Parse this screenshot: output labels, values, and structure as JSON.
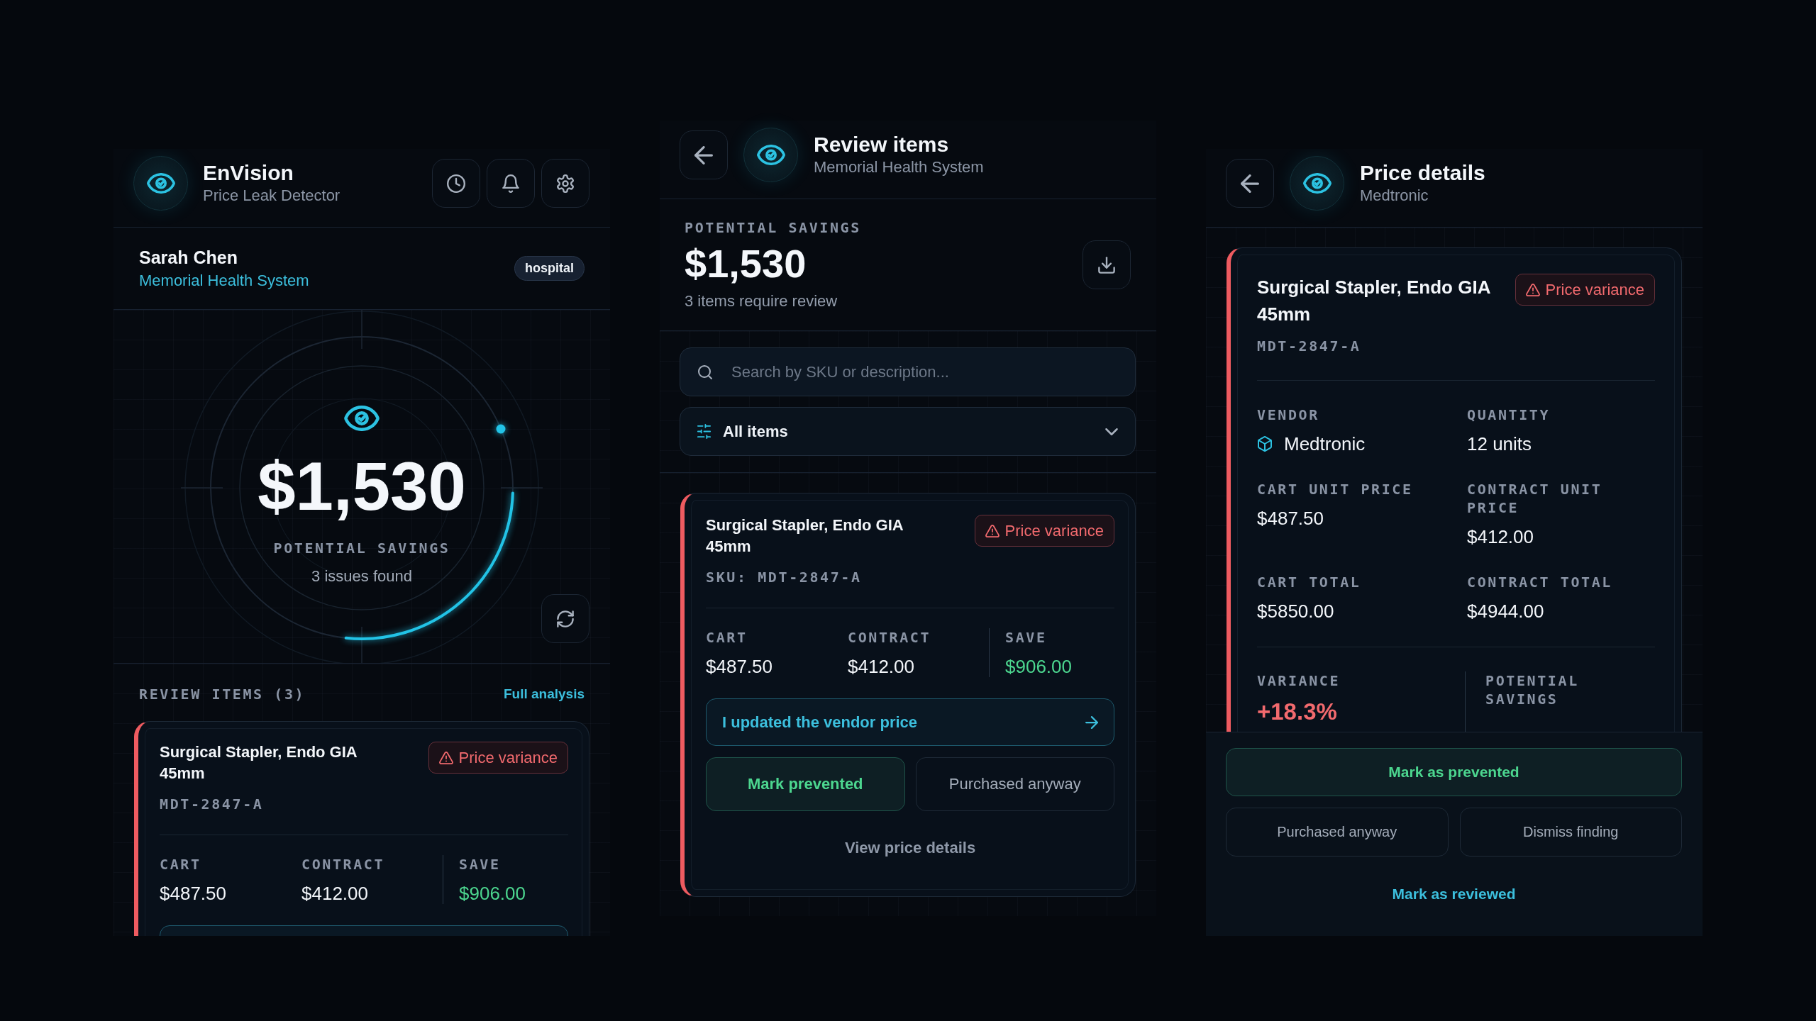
{
  "home_screen": {
    "brand": {
      "title": "EnVision",
      "subtitle": "Price Leak Detector"
    },
    "user": {
      "name": "Sarah Chen",
      "organization": "Memorial Health System",
      "badge": "hospital"
    },
    "summary": {
      "amount": "$1,530",
      "label": "POTENTIAL SAVINGS",
      "note": "3 issues found"
    },
    "review": {
      "heading": "REVIEW ITEMS (3)",
      "link": "Full analysis"
    },
    "items": [
      {
        "title": "Surgical Stapler, Endo GIA 45mm",
        "badge": "Price variance",
        "sku": "MDT-2847-A",
        "stats": [
          {
            "label": "CART",
            "value": "$487.50",
            "kind": "plain"
          },
          {
            "label": "CONTRACT",
            "value": "$412.00",
            "kind": "plain"
          },
          {
            "label": "SAVE",
            "value": "$906.00",
            "kind": "savings"
          }
        ]
      }
    ]
  },
  "review_screen": {
    "header": {
      "title": "Review items",
      "subtitle": "Memorial Health System"
    },
    "summary": {
      "label": "POTENTIAL SAVINGS",
      "amount": "$1,530",
      "note": "3 items require review"
    },
    "search": {
      "placeholder": "Search by SKU or description..."
    },
    "filter": {
      "value": "All items"
    },
    "items": [
      {
        "title": "Surgical Stapler, Endo GIA 45mm",
        "badge": "Price variance",
        "sku": "SKU: MDT-2847-A",
        "stats": [
          {
            "label": "CART",
            "value": "$487.50",
            "kind": "plain"
          },
          {
            "label": "CONTRACT",
            "value": "$412.00",
            "kind": "plain"
          },
          {
            "label": "SAVE",
            "value": "$906.00",
            "kind": "savings"
          }
        ],
        "actions": [
          {
            "label": "I updated the vendor price",
            "kind": "update"
          },
          {
            "label": "Mark prevented",
            "kind": "positive"
          },
          {
            "label": "Purchased anyway",
            "kind": "neutral"
          },
          {
            "label": "View price details",
            "kind": "link"
          }
        ]
      }
    ]
  },
  "details_screen": {
    "header": {
      "title": "Price details",
      "subtitle": "Medtronic"
    },
    "item": {
      "title": "Surgical Stapler, Endo GIA 45mm",
      "badge": "Price variance",
      "sku": "MDT-2847-A",
      "fields": [
        {
          "label": "VENDOR",
          "value": "Medtronic",
          "kind": "vendor"
        },
        {
          "label": "QUANTITY",
          "value": "12 units",
          "kind": "plain"
        },
        {
          "label": "CART UNIT PRICE",
          "value": "$487.50",
          "kind": "plain"
        },
        {
          "label": "CONTRACT UNIT PRICE",
          "value": "$412.00",
          "kind": "plain"
        },
        {
          "label": "CART TOTAL",
          "value": "$5850.00",
          "kind": "plain"
        },
        {
          "label": "CONTRACT TOTAL",
          "value": "$4944.00",
          "kind": "plain"
        }
      ],
      "summary": [
        {
          "label": "VARIANCE",
          "value": "+18.3%",
          "kind": "variance"
        },
        {
          "label": "POTENTIAL SAVINGS",
          "kind": "savings"
        }
      ]
    },
    "actions": [
      {
        "label": "Mark as prevented",
        "kind": "positive"
      },
      {
        "label": "Purchased anyway",
        "kind": "neutral"
      },
      {
        "label": "Dismiss finding",
        "kind": "neutral"
      },
      {
        "label": "Mark as reviewed",
        "kind": "link"
      }
    ]
  }
}
